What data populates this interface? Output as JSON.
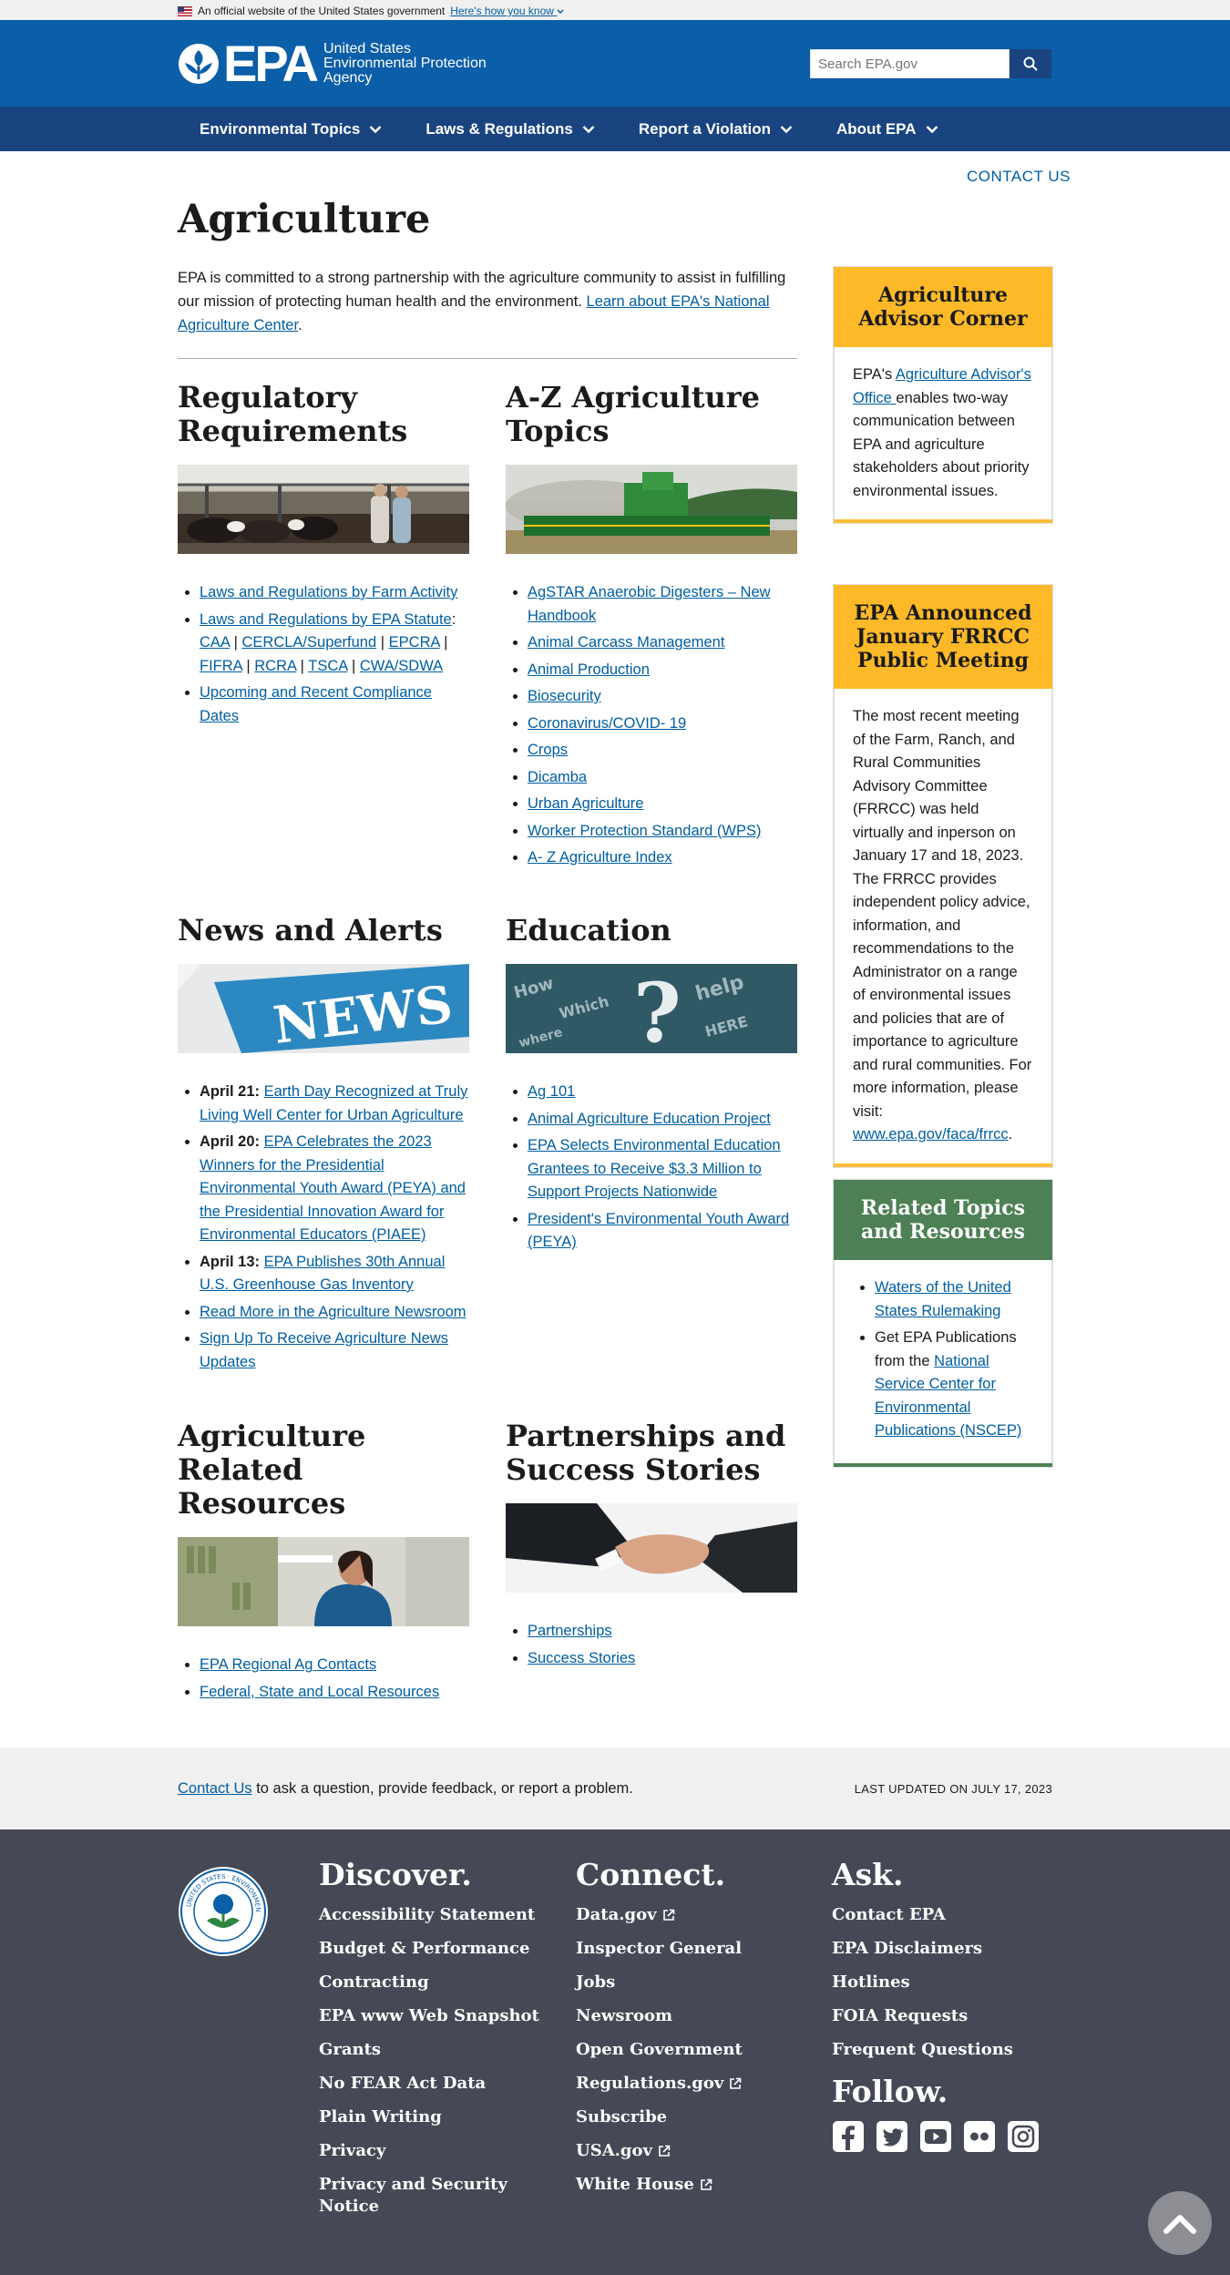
{
  "banner": {
    "text": "An official website of the United States government",
    "how": "Here's how you know"
  },
  "header": {
    "logo_text": "EPA",
    "logo_sub": [
      "United States",
      "Environmental Protection",
      "Agency"
    ],
    "search_placeholder": "Search EPA.gov"
  },
  "nav": [
    "Environmental Topics",
    "Laws & Regulations",
    "Report a Violation",
    "About EPA"
  ],
  "contact_top": "CONTACT US",
  "page_title": "Agriculture",
  "intro": {
    "text": "EPA is committed to a strong partnership with the agriculture community to assist in fulfilling our mission of protecting human health and the environment. ",
    "link": "Learn about EPA's National Agriculture Center",
    "end": "."
  },
  "regulatory": {
    "title": "Regulatory Requirements",
    "item1": "Laws and Regulations by Farm Activity",
    "item2": "Laws and Regulations by EPA Statute",
    "statutes": [
      "CAA",
      "CERCLA/Superfund",
      "EPCRA",
      "FIFRA",
      "RCRA",
      "TSCA",
      "CWA/SDWA"
    ],
    "item3": "Upcoming and Recent Compliance Dates"
  },
  "az": {
    "title": "A-Z Agriculture Topics",
    "items": [
      "AgSTAR Anaerobic Digesters – New Handbook",
      "Animal Carcass Management",
      "Animal Production",
      "Biosecurity",
      "Coronavirus/COVID- 19",
      "Crops",
      "Dicamba",
      "Urban Agriculture",
      "Worker Protection Standard (WPS)",
      "A- Z Agriculture Index "
    ]
  },
  "news": {
    "title": "News and Alerts",
    "image_text": "NEWS",
    "items": [
      {
        "date": "April 21:",
        "text": "Earth Day Recognized at Truly Living Well Center for Urban Agriculture"
      },
      {
        "date": "April 20:",
        "text": "EPA Celebrates the 2023 Winners for the Presidential Environmental Youth Award (PEYA) and the Presidential Innovation Award for Environmental Educators (PIAEE)"
      },
      {
        "date": "April 13:",
        "text": "EPA Publishes 30th Annual U.S. Greenhouse Gas Inventory"
      }
    ],
    "more": "Read More in the Agriculture Newsroom",
    "signup": "Sign Up To Receive Agriculture News Updates"
  },
  "education": {
    "title": "Education",
    "items": [
      "Ag 101",
      "Animal Agriculture Education Project",
      "EPA Selects Environmental Education Grantees to Receive $3.3 Million to Support Projects Nationwide",
      "President's Environmental Youth Award (PEYA)"
    ]
  },
  "resources": {
    "title": "Agriculture Related Resources",
    "items": [
      "EPA Regional Ag Contacts",
      "Federal, State and Local Resources"
    ]
  },
  "partnerships": {
    "title": "Partnerships and Success Stories",
    "items": [
      "Partnerships",
      "Success Stories"
    ]
  },
  "advisor_box": {
    "title": "Agriculture Advisor Corner",
    "pre": "EPA's ",
    "link": "Agriculture Advisor's Office ",
    "post": "enables two-way communication between EPA and agriculture stakeholders about priority environmental issues."
  },
  "frrcc_box": {
    "title": "EPA Announced January FRRCC Public Meeting",
    "text": "The most recent meeting of the Farm, Ranch, and Rural Communities Advisory Committee (FRRCC) was held virtually and inperson on January 17 and 18, 2023. The FRRCC provides independent policy advice, information, and recommendations to the Administrator on a range of environmental issues and policies that are of importance to agriculture and rural communities. For more information, please visit: ",
    "link": "www.epa.gov/faca/frrcc",
    "end": "."
  },
  "related_box": {
    "title": "Related Topics and Resources",
    "item1": "Waters of the United States Rulemaking",
    "item2_pre": "Get EPA Publications from the ",
    "item2_link": "National Service Center for Environmental Publications (NSCEP)"
  },
  "bottom_strip": {
    "contact": "Contact Us",
    "text": " to ask a question, provide feedback, or report a problem.",
    "updated": "LAST UPDATED ON JULY 17, 2023"
  },
  "footer": {
    "discover": {
      "title": "Discover.",
      "items": [
        "Accessibility Statement",
        "Budget & Performance",
        "Contracting",
        "EPA www Web Snapshot",
        "Grants",
        "No FEAR Act Data",
        "Plain Writing",
        "Privacy",
        "Privacy and Security Notice"
      ]
    },
    "connect": {
      "title": "Connect.",
      "items": [
        "Data.gov",
        "Inspector General",
        "Jobs",
        "Newsroom",
        "Open Government",
        "Regulations.gov",
        "Subscribe",
        "USA.gov",
        "White House"
      ]
    },
    "ask": {
      "title": "Ask.",
      "items": [
        "Contact EPA",
        "EPA Disclaimers",
        "Hotlines",
        "FOIA Requests",
        "Frequent Questions"
      ]
    },
    "follow": {
      "title": "Follow."
    },
    "seal_text": "UNITED STATES ENVIRONMENTAL PROTECTION AGENCY"
  },
  "colors": {
    "header": "#0b5ea8",
    "nav": "#1a4480",
    "gold": "#fdb928",
    "green": "#4d8055",
    "footer": "#454955",
    "link": "#005ea2"
  }
}
